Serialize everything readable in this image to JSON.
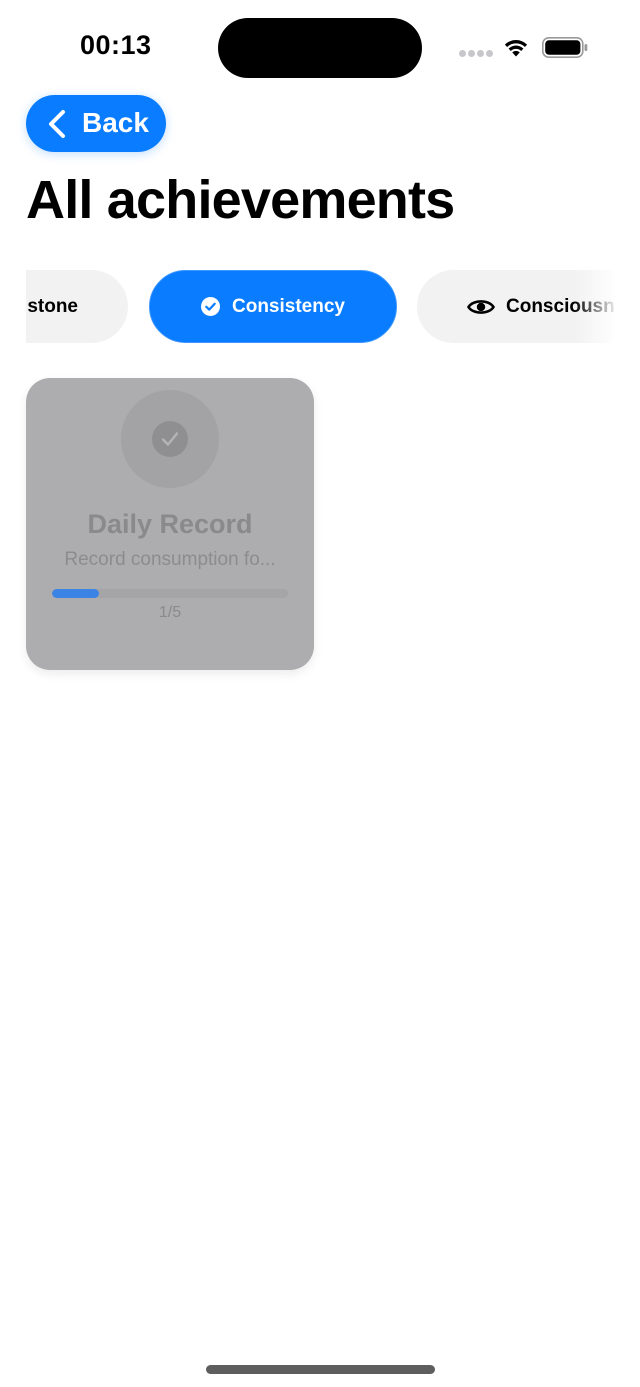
{
  "status_bar": {
    "time": "00:13"
  },
  "header": {
    "back_label": "Back",
    "title": "All achievements"
  },
  "categories": [
    {
      "label": "Milestone",
      "visible_text": "stone",
      "selected": false
    },
    {
      "label": "Consistency",
      "visible_text": "Consistency",
      "selected": true,
      "icon": "checkmark-circle-icon"
    },
    {
      "label": "Consciousness",
      "visible_text": "Consciousn",
      "selected": false,
      "icon": "eye-icon"
    }
  ],
  "achievements": [
    {
      "title": "Daily Record",
      "description": "Record consumption fo...",
      "progress_text": "1/5",
      "progress_value": 0.2,
      "icon": "checkmark-icon",
      "locked": true
    }
  ],
  "colors": {
    "accent": "#0a7cff",
    "chip_bg": "#f2f2f2",
    "card_locked_bg": "#adadaf",
    "progress_fill": "#3b84e6"
  }
}
